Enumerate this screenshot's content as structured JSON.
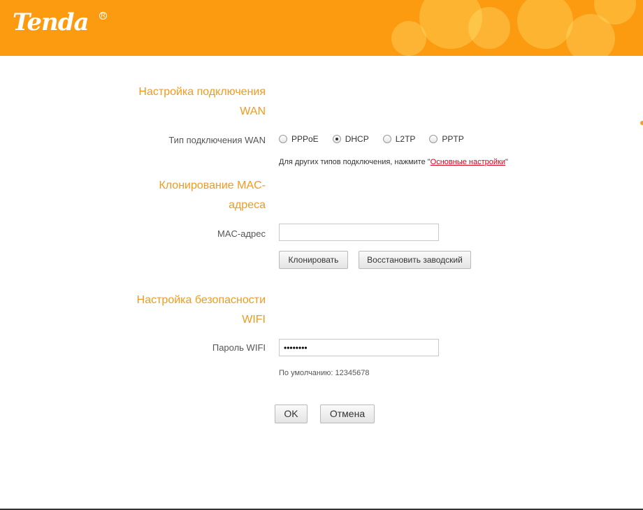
{
  "header": {
    "logo": "Tenda",
    "logo_mark": "R"
  },
  "wan": {
    "title_line1": "Настройка подключения",
    "title_line2": "WAN",
    "type_label": "Тип подключения WAN",
    "options": [
      "PPPoE",
      "DHCP",
      "L2TP",
      "PPTP"
    ],
    "selected": "DHCP",
    "hint_prefix": "Для других типов подключения, нажмите \"",
    "hint_link": "Основные настройки",
    "hint_suffix": "\""
  },
  "mac": {
    "title_line1": "Клонирование MAC-",
    "title_line2": "адреса",
    "label": "MAC-адрес",
    "value": "",
    "clone_button": "Клонировать",
    "restore_button": "Восстановить заводский"
  },
  "wifi": {
    "title_line1": "Настройка безопасности",
    "title_line2": "WIFI",
    "label": "Пароль WIFI",
    "value": "12345678",
    "default_hint": "По умолчанию: 12345678"
  },
  "actions": {
    "ok": "OK",
    "cancel": "Отмена"
  },
  "colors": {
    "header": "#fc9a10",
    "accent": "#f39a1e",
    "link": "#d6001c"
  }
}
